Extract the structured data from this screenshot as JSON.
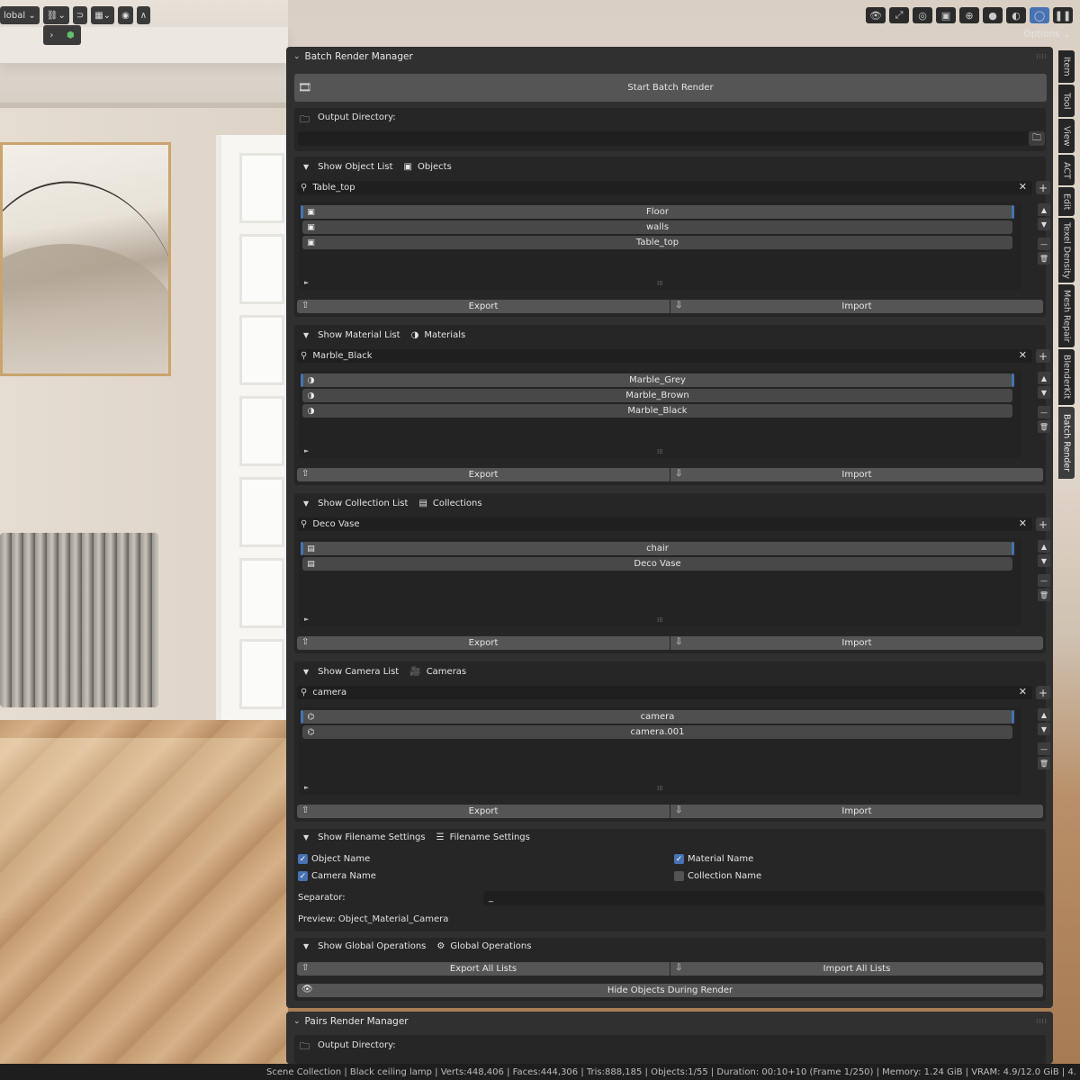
{
  "toolbar": {
    "transform_orientation": "lobal",
    "options_label": "Options"
  },
  "panel": {
    "title": "Batch Render Manager",
    "start_button": "Start Batch Render",
    "output_label": "Output Directory:",
    "output_value": "",
    "objects": {
      "toggle_label": "Show Object List",
      "section_label": "Objects",
      "search": "Table_top",
      "items": [
        "Floor",
        "walls",
        "Table_top"
      ],
      "export": "Export",
      "import": "Import"
    },
    "materials": {
      "toggle_label": "Show Material List",
      "section_label": "Materials",
      "search": "Marble_Black",
      "items": [
        "Marble_Grey",
        "Marble_Brown",
        "Marble_Black"
      ],
      "export": "Export",
      "import": "Import"
    },
    "collections": {
      "toggle_label": "Show Collection List",
      "section_label": "Collections",
      "search": "Deco Vase",
      "items": [
        "chair",
        "Deco Vase"
      ],
      "export": "Export",
      "import": "Import"
    },
    "cameras": {
      "toggle_label": "Show Camera List",
      "section_label": "Cameras",
      "search": "camera",
      "items": [
        "camera",
        "camera.001"
      ],
      "export": "Export",
      "import": "Import"
    },
    "filename": {
      "toggle_label": "Show Filename Settings",
      "section_label": "Filename Settings",
      "object_name": "Object Name",
      "object_checked": true,
      "material_name": "Material Name",
      "material_checked": true,
      "camera_name": "Camera Name",
      "camera_checked": true,
      "collection_name": "Collection Name",
      "collection_checked": false,
      "separator_label": "Separator:",
      "separator_value": "_",
      "preview": "Preview: Object_Material_Camera"
    },
    "global": {
      "toggle_label": "Show Global Operations",
      "section_label": "Global Operations",
      "export_all": "Export All Lists",
      "import_all": "Import All Lists",
      "hide_objects": "Hide Objects During Render"
    }
  },
  "pairs_panel": {
    "title": "Pairs Render Manager",
    "output_label": "Output Directory:"
  },
  "side_tabs": [
    "Item",
    "Tool",
    "View",
    "ACT",
    "Edit",
    "Texel Density",
    "Mesh Repair",
    "BlenderKit",
    "Batch Render"
  ],
  "status": {
    "text": "Scene Collection | Black ceiling lamp | Verts:448,406 | Faces:444,306 | Tris:888,185 | Objects:1/55 | Duration: 00:10+10 (Frame 1/250) | Memory: 1.24 GiB | VRAM: 4.9/12.0 GiB | 4."
  },
  "colors": {
    "accent": "#4772b3",
    "panel": "#303030",
    "button": "#555555"
  },
  "icons": {
    "search": "search-icon",
    "close": "close-icon",
    "plus": "plus-icon",
    "folder": "folder-icon",
    "export": "export-icon",
    "import": "import-icon",
    "eye": "eye-icon",
    "gear": "gear-icon",
    "camera": "camera-icon",
    "material": "material-icon",
    "collection": "collection-icon",
    "object": "object-icon",
    "render": "render-icon"
  }
}
